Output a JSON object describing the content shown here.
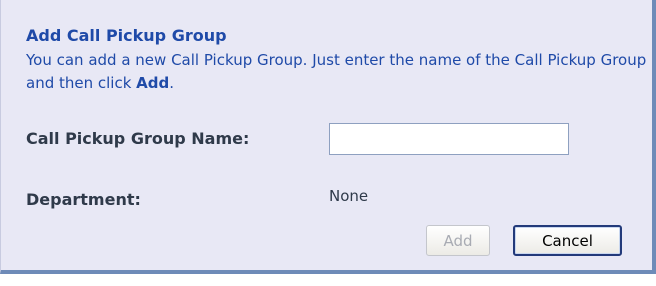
{
  "dialog": {
    "title": "Add Call Pickup Group",
    "description_prefix": "You can add a new Call Pickup Group. Just enter the name of the Call Pickup Group and then click ",
    "description_bold": "Add",
    "description_suffix": "."
  },
  "form": {
    "name_label": "Call Pickup Group Name:",
    "name_value": "",
    "department_label": "Department:",
    "department_value": "None"
  },
  "buttons": {
    "add_label": "Add",
    "add_disabled": true,
    "cancel_label": "Cancel"
  }
}
